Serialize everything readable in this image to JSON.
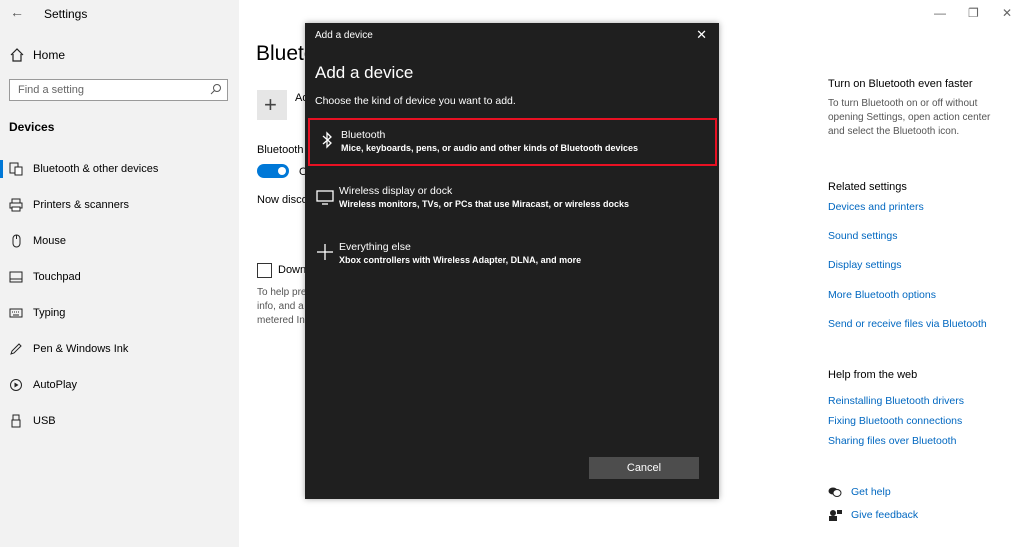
{
  "app": {
    "title": "Settings"
  },
  "sidebar": {
    "home_label": "Home",
    "search_placeholder": "Find a setting",
    "section_label": "Devices",
    "items": [
      {
        "label": "Bluetooth & other devices",
        "icon": "bluetooth-devices-icon",
        "active": true
      },
      {
        "label": "Printers & scanners",
        "icon": "printer-icon"
      },
      {
        "label": "Mouse",
        "icon": "mouse-icon"
      },
      {
        "label": "Touchpad",
        "icon": "touchpad-icon"
      },
      {
        "label": "Typing",
        "icon": "keyboard-icon"
      },
      {
        "label": "Pen & Windows Ink",
        "icon": "pen-icon"
      },
      {
        "label": "AutoPlay",
        "icon": "autoplay-icon"
      },
      {
        "label": "USB",
        "icon": "usb-icon"
      }
    ]
  },
  "main": {
    "title": "Blueto",
    "add_label": "Ad",
    "bluetooth_label": "Bluetooth",
    "toggle_label": "O",
    "discoverable_text": "Now disco",
    "checkbox_label": "Down",
    "info_lines": [
      "To help pre",
      "info, and a",
      "metered In"
    ]
  },
  "right": {
    "faster_heading": "Turn on Bluetooth even faster",
    "faster_text": "To turn Bluetooth on or off without opening Settings, open action center and select the Bluetooth icon.",
    "related_heading": "Related settings",
    "related_links": [
      "Devices and printers",
      "Sound settings",
      "Display settings",
      "More Bluetooth options",
      "Send or receive files via Bluetooth"
    ],
    "web_heading": "Help from the web",
    "web_links": [
      "Reinstalling Bluetooth drivers",
      "Fixing Bluetooth connections",
      "Sharing files over Bluetooth"
    ],
    "get_help": "Get help",
    "feedback": "Give feedback"
  },
  "dialog": {
    "window_title": "Add a device",
    "heading": "Add a device",
    "subheading": "Choose the kind of device you want to add.",
    "options": [
      {
        "title": "Bluetooth",
        "desc": "Mice, keyboards, pens, or audio and other kinds of Bluetooth devices",
        "icon": "bluetooth-icon",
        "highlighted": true
      },
      {
        "title": "Wireless display or dock",
        "desc": "Wireless monitors, TVs, or PCs that use Miracast, or wireless docks",
        "icon": "monitor-icon"
      },
      {
        "title": "Everything else",
        "desc": "Xbox controllers with Wireless Adapter, DLNA, and more",
        "icon": "plus-icon"
      }
    ],
    "cancel_label": "Cancel"
  },
  "colors": {
    "accent": "#0078d7",
    "highlight": "#e81123",
    "link": "#0067c0",
    "dialog_bg": "#1f1f1f"
  }
}
